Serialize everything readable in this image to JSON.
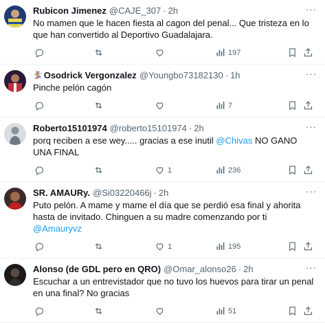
{
  "tweets": [
    {
      "name": "Rubicon Jimenez",
      "prefix": "",
      "handle": "@CAJE_307",
      "sep": "·",
      "time": "2h",
      "text": "No mamen que le hacen fiesta al cagon del penal... Que tristeza en lo que han convertido al Deportivo Guadalajara.",
      "link": "",
      "text_after": "",
      "replies": "",
      "retweets": "",
      "likes": "",
      "views": "197"
    },
    {
      "name": "Osodrick Vergonzalez",
      "prefix": "🏂",
      "handle": "@Youngbo73182130",
      "sep": "·",
      "time": "1h",
      "text": "Pinche pelón cagón",
      "link": "",
      "text_after": "",
      "replies": "",
      "retweets": "",
      "likes": "",
      "views": "7"
    },
    {
      "name": "Roberto15101974",
      "prefix": "",
      "handle": "@roberto15101974",
      "sep": "·",
      "time": "2h",
      "text": "porq reciben a ese wey..... gracias a ese inutil ",
      "link": "@Chivas",
      "text_after": " NO GANO UNA FINAL",
      "replies": "",
      "retweets": "",
      "likes": "1",
      "views": "236"
    },
    {
      "name": "SR. AMAURy.",
      "prefix": "",
      "handle": "@Si03220466j",
      "sep": "·",
      "time": "2h",
      "text": "Puto pelón. A mame y mame el día que se perdió esa final y ahorita hasta de invitado. Chinguen a su madre comenzando por ti ",
      "link": "@Amauryvz",
      "text_after": "",
      "replies": "",
      "retweets": "",
      "likes": "1",
      "views": "195"
    },
    {
      "name": "Alonso (de GDL pero en QRO)",
      "prefix": "",
      "handle": "@Omar_alonso26",
      "sep": "·",
      "time": "2h",
      "text": "Escuchar a un entrevistador que no tuvo los huevos para tirar un penal en una final? No gracias",
      "link": "",
      "text_after": "",
      "replies": "",
      "retweets": "",
      "likes": "",
      "views": "51"
    }
  ],
  "more_label": "···",
  "icons": {
    "reply": "reply-icon",
    "retweet": "retweet-icon",
    "like": "heart-icon",
    "views": "views-icon",
    "bookmark": "bookmark-icon",
    "share": "share-icon"
  },
  "colors": {
    "text": "#0f1419",
    "secondary": "#536471",
    "link": "#1d9bf0",
    "divider": "#eff3f4"
  }
}
